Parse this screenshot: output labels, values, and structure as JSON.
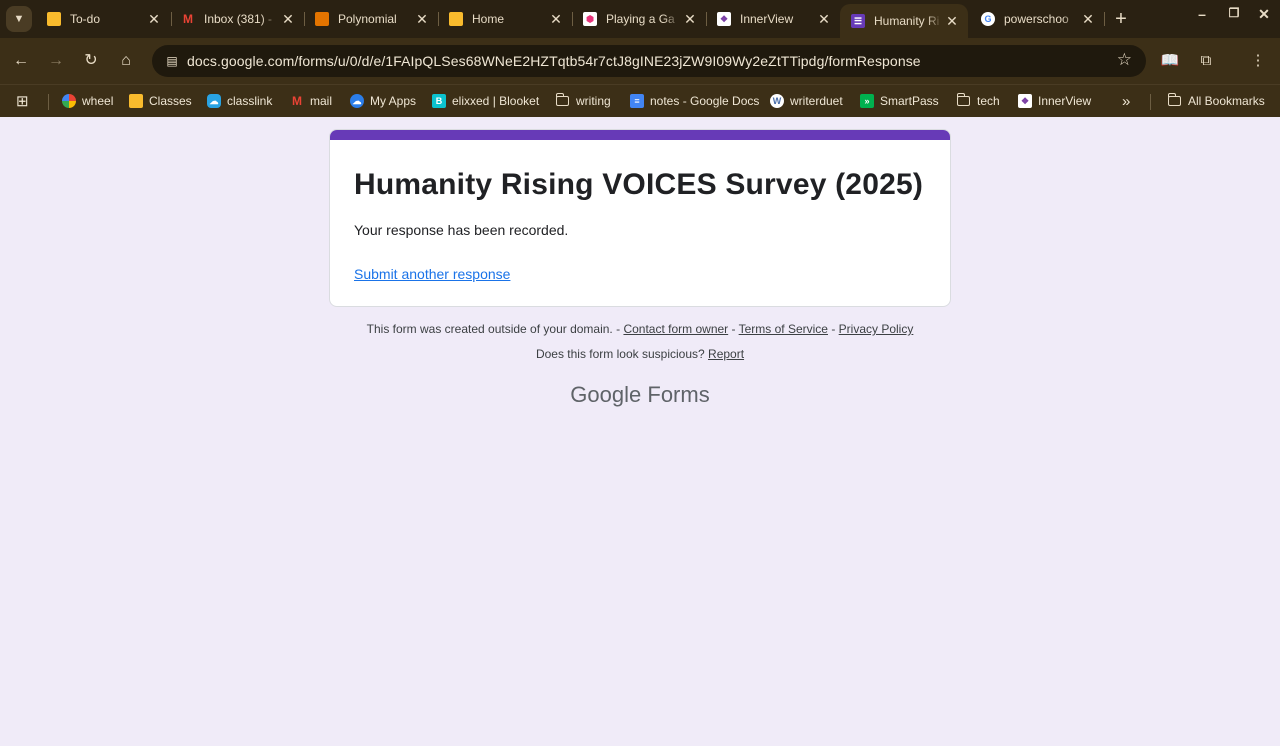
{
  "browser": {
    "tabs": [
      {
        "title": "To-do",
        "icon": "google-classroom-icon",
        "color": "#f9bb2d",
        "active": false
      },
      {
        "title": "Inbox (381) -",
        "icon": "gmail-icon",
        "color": "#ea4335",
        "active": false
      },
      {
        "title": "Polynomial",
        "icon": "slides-icon",
        "color": "#e37400",
        "active": false
      },
      {
        "title": "Home",
        "icon": "google-classroom-icon",
        "color": "#f9bb2d",
        "active": false
      },
      {
        "title": "Playing a Ga",
        "icon": "blooket-icon",
        "color": "#e8347a",
        "active": false
      },
      {
        "title": "InnerView",
        "icon": "innerview-icon",
        "color": "#7b3fa5",
        "active": false
      },
      {
        "title": "Humanity Ri",
        "icon": "google-forms-icon",
        "color": "#673ab7",
        "active": true
      },
      {
        "title": "powerschoo",
        "icon": "google-icon",
        "color": "#4285f4",
        "active": false
      }
    ],
    "url": "docs.google.com/forms/u/0/d/e/1FAIpQLSes68WNeE2HZTqtb54r7ctJ8gINE23jZW9I09Wy2eZtTTipdg/formResponse",
    "bookmarks": [
      {
        "label": "wheel",
        "icon": "wheel-icon",
        "color": "#ea4335"
      },
      {
        "label": "Classes",
        "icon": "google-classroom-icon",
        "color": "#f9bb2d"
      },
      {
        "label": "classlink",
        "icon": "classlink-icon",
        "color": "#29a3e3"
      },
      {
        "label": "mail",
        "icon": "gmail-icon",
        "color": "#ea4335"
      },
      {
        "label": "My Apps",
        "icon": "my-apps-icon",
        "color": "#2b7de9"
      },
      {
        "label": "elixxed | Blooket",
        "icon": "blooket-icon",
        "color": "#0bc2cf"
      },
      {
        "label": "writing",
        "icon": "folder-icon",
        "color": ""
      },
      {
        "label": "notes - Google Docs",
        "icon": "google-docs-icon",
        "color": "#4285f4"
      },
      {
        "label": "writerduet",
        "icon": "writerduet-icon",
        "color": "#8ab4f8"
      },
      {
        "label": "SmartPass",
        "icon": "smartpass-icon",
        "color": "#00b14f"
      },
      {
        "label": "tech",
        "icon": "folder-icon",
        "color": ""
      },
      {
        "label": "InnerView",
        "icon": "innerview-icon",
        "color": "#7b3fa5"
      }
    ],
    "all_bookmarks_label": "All Bookmarks"
  },
  "form": {
    "title": "Humanity Rising VOICES Survey (2025)",
    "confirmation": "Your response has been recorded.",
    "submit_another": "Submit another response",
    "accent_color": "#673ab7"
  },
  "footer": {
    "created_outside": "This form was created outside of your domain.",
    "contact_owner": "Contact form owner",
    "terms": "Terms of Service",
    "privacy": "Privacy Policy",
    "suspicious": "Does this form look suspicious?",
    "report": "Report",
    "brand_google": "Google",
    "brand_forms": "Forms"
  }
}
